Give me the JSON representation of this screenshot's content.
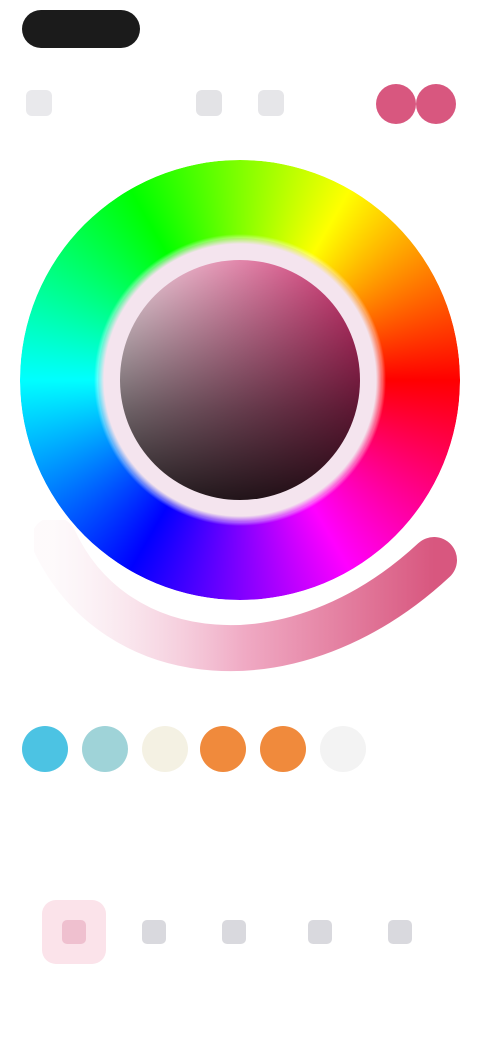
{
  "status_bar": {},
  "toolbar": {
    "back_icon": "chevron-left-icon",
    "undo_icon": "undo-icon",
    "redo_icon": "redo-icon",
    "current_colors": [
      "#d8577f",
      "#d8577f"
    ]
  },
  "color_picker": {
    "selected_hue": "#d0306f",
    "wheel_colors": [
      "#ff0000",
      "#ff00ff",
      "#0000ff",
      "#00ffff",
      "#00ff00",
      "#ffff00"
    ]
  },
  "recent_swatches": [
    {
      "color": "#4cc3e3"
    },
    {
      "color": "#9fd3d8"
    },
    {
      "color": "#f4f1e3"
    },
    {
      "color": "#f08a3c"
    },
    {
      "color": "#f08a3c"
    },
    {
      "color": "#f3f3f3"
    }
  ],
  "bottom_tabs": [
    {
      "icon": "wheel-icon",
      "active": true
    },
    {
      "icon": "grid-icon",
      "active": false
    },
    {
      "icon": "sliders-icon",
      "active": false
    },
    {
      "icon": "palette-icon",
      "active": false
    },
    {
      "icon": "eyedropper-icon",
      "active": false
    }
  ]
}
